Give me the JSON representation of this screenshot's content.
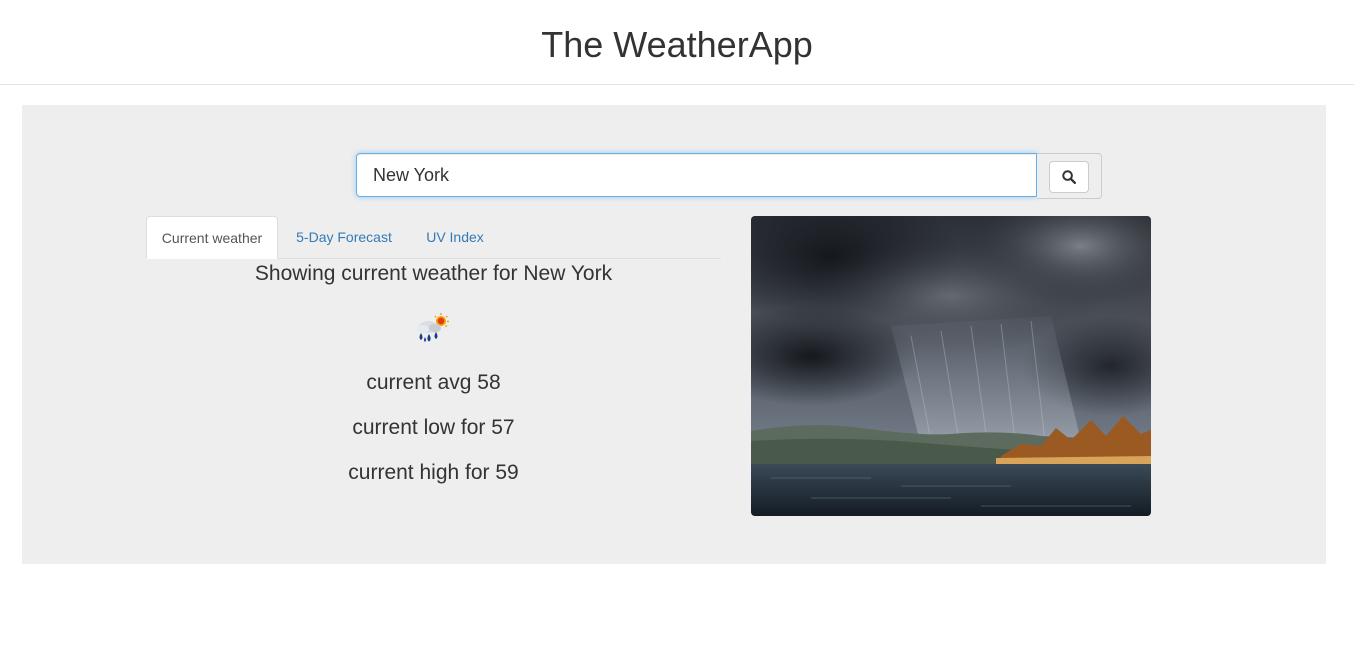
{
  "app": {
    "title": "The WeatherApp"
  },
  "search": {
    "value": "New York",
    "button_icon": "search-icon"
  },
  "tabs": [
    {
      "label": "Current weather",
      "active": true
    },
    {
      "label": "5-Day Forecast",
      "active": false
    },
    {
      "label": "UV Index",
      "active": false
    }
  ],
  "current": {
    "heading": "Showing current weather for New York",
    "icon": "rain-and-sun-icon",
    "avg": "current avg 58",
    "low": "current low for 57",
    "high": "current high for 59"
  },
  "photo": {
    "subject": "storm-over-lake-image"
  },
  "colors": {
    "link": "#337ab7",
    "panel_bg": "#eeeeee",
    "focus_border": "#66afe9"
  }
}
